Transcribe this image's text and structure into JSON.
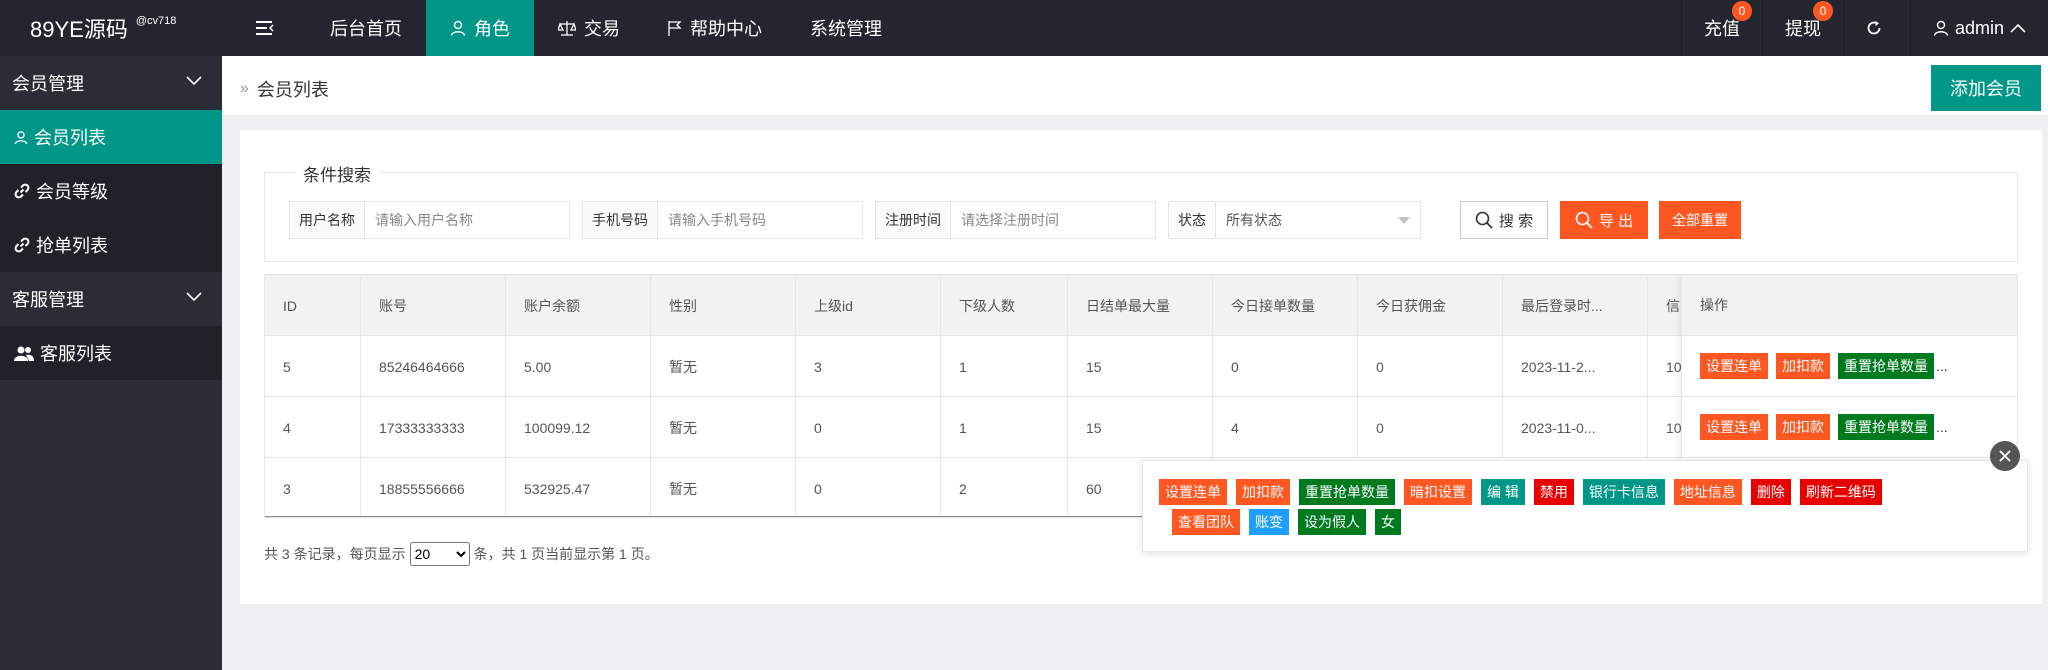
{
  "app": {
    "logo_text": "89YE源码",
    "logo_sup": "@cv718"
  },
  "topnav": [
    {
      "label": "后台首页"
    },
    {
      "label": "角色"
    },
    {
      "label": "交易"
    },
    {
      "label": "帮助中心"
    },
    {
      "label": "系统管理"
    }
  ],
  "topright": {
    "recharge": {
      "label": "充值",
      "badge": "0"
    },
    "withdraw": {
      "label": "提现",
      "badge": "0"
    },
    "user": "admin"
  },
  "sidebar": {
    "group1": "会员管理",
    "items1": [
      "会员列表",
      "会员等级",
      "抢单列表"
    ],
    "group2": "客服管理",
    "items2": [
      "客服列表"
    ]
  },
  "breadcrumb": {
    "current": "会员列表",
    "sep": "»"
  },
  "add_button": "添加会员",
  "search": {
    "legend": "条件搜索",
    "username_label": "用户名称",
    "username_placeholder": "请输入用户名称",
    "phone_label": "手机号码",
    "phone_placeholder": "请输入手机号码",
    "regtime_label": "注册时间",
    "regtime_placeholder": "请选择注册时间",
    "status_label": "状态",
    "status_value": "所有状态",
    "search_btn": "搜 索",
    "export_btn": "导 出",
    "reset_btn": "全部重置"
  },
  "table": {
    "headers": [
      "ID",
      "账号",
      "账户余额",
      "性别",
      "上级id",
      "下级人数",
      "日结单最大量",
      "今日接单数量",
      "今日获佣金",
      "最后登录时...",
      "信",
      "操作"
    ],
    "rows": [
      [
        "5",
        "85246464666",
        "5.00",
        "暂无",
        "3",
        "1",
        "15",
        "0",
        "0",
        "2023-11-2...",
        "10"
      ],
      [
        "4",
        "17333333333",
        "100099.12",
        "暂无",
        "0",
        "1",
        "15",
        "4",
        "0",
        "2023-11-0...",
        "10"
      ],
      [
        "3",
        "18855556666",
        "532925.47",
        "暂无",
        "0",
        "2",
        "60",
        "",
        "",
        "",
        ""
      ]
    ],
    "row_ops": [
      "设置连单",
      "加扣款",
      "重置抢单数量"
    ],
    "ellipsis": "..."
  },
  "pager": {
    "prefix": "共 3 条记录，每页显示",
    "page_size": "20",
    "suffix": "条，共 1 页当前显示第 1 页。"
  },
  "popup": {
    "tags": [
      {
        "label": "设置连单",
        "color": "#ff5722"
      },
      {
        "label": "加扣款",
        "color": "#ff5722"
      },
      {
        "label": "重置抢单数量",
        "color": "#007a1f"
      },
      {
        "label": "暗扣设置",
        "color": "#ff5722"
      },
      {
        "label": "编 辑",
        "color": "#009688"
      },
      {
        "label": "禁用",
        "color": "#e60000"
      },
      {
        "label": "银行卡信息",
        "color": "#009688"
      },
      {
        "label": "地址信息",
        "color": "#ff5722"
      },
      {
        "label": "删除",
        "color": "#e60000"
      },
      {
        "label": "刷新二维码",
        "color": "#e60000"
      },
      {
        "label": "查看团队",
        "color": "#ff5722"
      },
      {
        "label": "账变",
        "color": "#1e9fff"
      },
      {
        "label": "设为假人",
        "color": "#007a1f"
      },
      {
        "label": "女",
        "color": "#007a1f"
      }
    ]
  },
  "colors": {
    "accent": "#009688",
    "topbar": "#23262e",
    "sidebar": "#2a2d35",
    "danger": "#ff5722"
  }
}
